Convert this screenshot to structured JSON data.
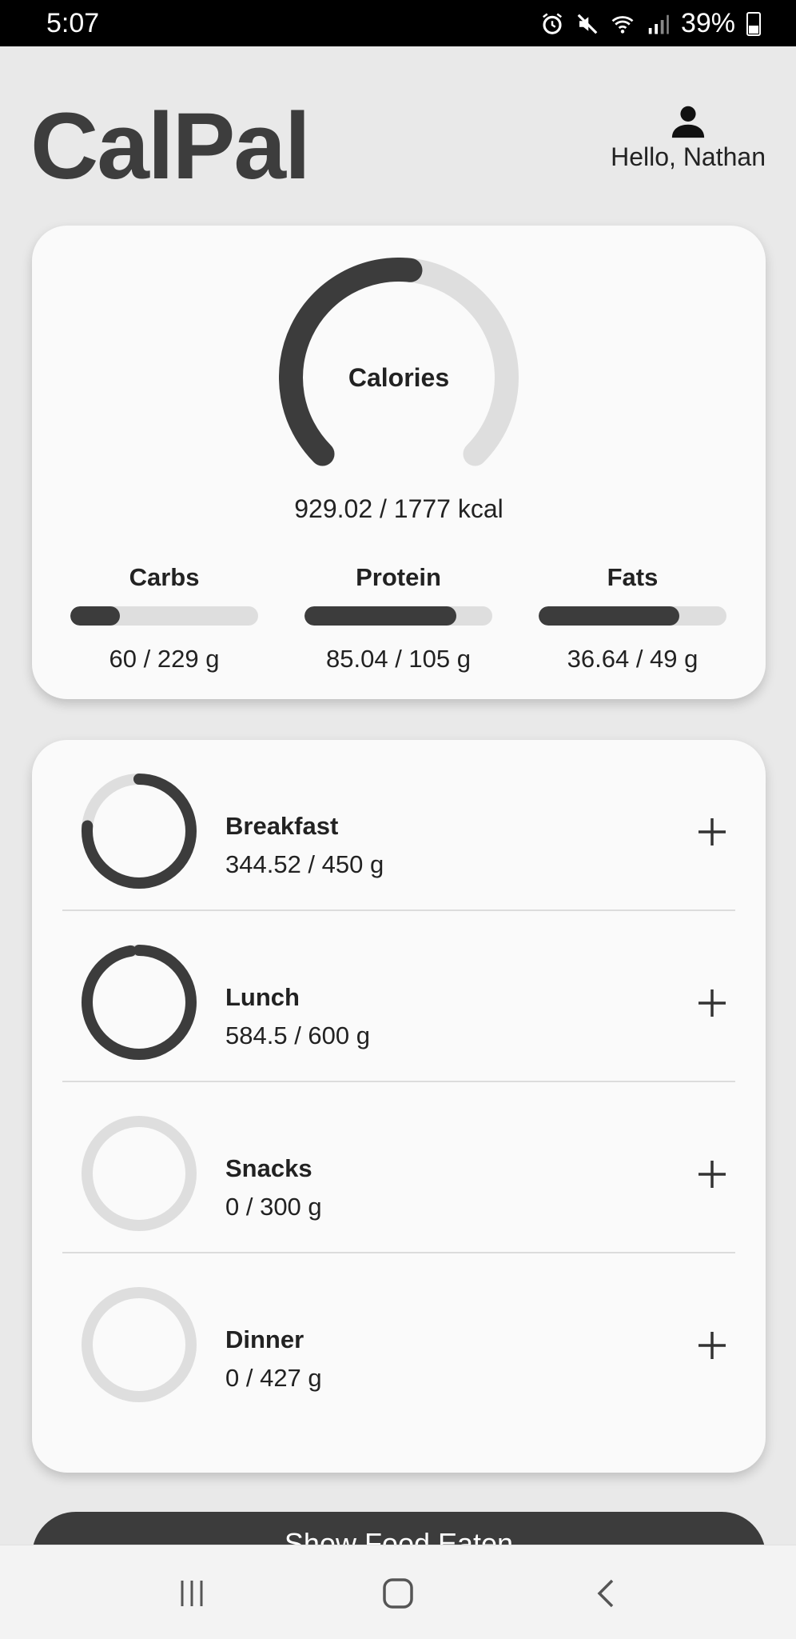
{
  "status_bar": {
    "time": "5:07",
    "battery": "39%",
    "icons": [
      "alarm-icon",
      "mute-icon",
      "wifi-icon",
      "signal-icon",
      "battery-icon"
    ]
  },
  "header": {
    "app_title": "CalPal",
    "greeting": "Hello, Nathan",
    "icon": "person-icon"
  },
  "summary": {
    "calories": {
      "label": "Calories",
      "value_text": "929.02 / 1777 kcal",
      "consumed": 929.02,
      "goal": 1777
    },
    "macros": [
      {
        "name": "Carbs",
        "value_text": "60 / 229 g",
        "consumed": 60,
        "goal": 229
      },
      {
        "name": "Protein",
        "value_text": "85.04 / 105 g",
        "consumed": 85.04,
        "goal": 105
      },
      {
        "name": "Fats",
        "value_text": "36.64 / 49 g",
        "consumed": 36.64,
        "goal": 49
      }
    ]
  },
  "meals": [
    {
      "name": "Breakfast",
      "value_text": "344.52 / 450 g",
      "consumed": 344.52,
      "goal": 450
    },
    {
      "name": "Lunch",
      "value_text": "584.5 / 600 g",
      "consumed": 584.5,
      "goal": 600
    },
    {
      "name": "Snacks",
      "value_text": "0 / 300 g",
      "consumed": 0,
      "goal": 300
    },
    {
      "name": "Dinner",
      "value_text": "0 / 427 g",
      "consumed": 0,
      "goal": 427
    }
  ],
  "bottom_button": {
    "label": "Show Food Eaten"
  },
  "nav": {
    "icons": [
      "recent-apps-icon",
      "home-icon",
      "back-icon"
    ]
  },
  "colors": {
    "accent": "#3c3c3c",
    "track": "#dedede",
    "background": "#e9e9e9",
    "card": "#fafafa"
  }
}
